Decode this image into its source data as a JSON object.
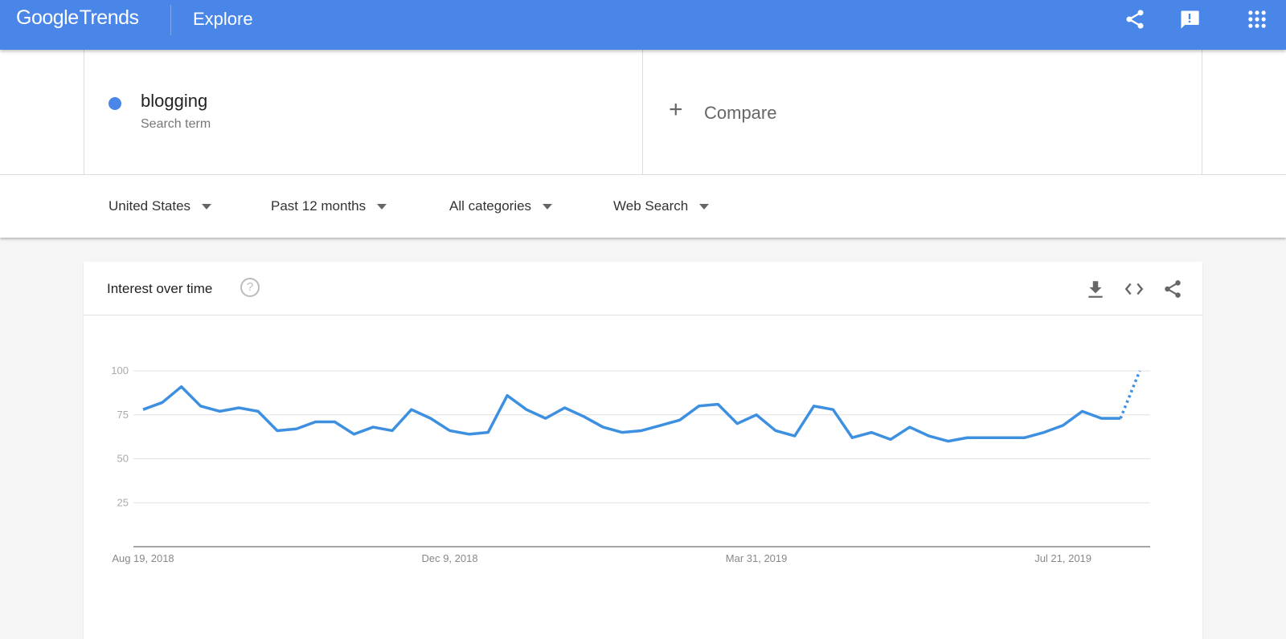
{
  "header": {
    "logo_google": "Google",
    "logo_trends": "Trends",
    "section": "Explore",
    "icons": [
      "share-icon",
      "feedback-icon",
      "apps-grid-icon"
    ],
    "bar_color": "#4a86e8"
  },
  "search": {
    "term": "blogging",
    "term_type": "Search term",
    "term_color": "#4a86e8",
    "compare_label": "Compare",
    "compare_icon": "plus-icon"
  },
  "filters": {
    "region": "United States",
    "time_range": "Past 12 months",
    "category": "All categories",
    "search_type": "Web Search"
  },
  "card": {
    "title": "Interest over time",
    "help_glyph": "?",
    "icons": [
      "download-icon",
      "embed-code-icon",
      "share-icon"
    ]
  },
  "chart_data": {
    "type": "line",
    "title": "Interest over time",
    "xlabel": "",
    "ylabel": "",
    "ylim": [
      0,
      100
    ],
    "yticks": [
      25,
      50,
      75,
      100
    ],
    "grid": true,
    "legend": "none",
    "x_tick_labels": [
      "Aug 19, 2018",
      "Dec 9, 2018",
      "Mar 31, 2019",
      "Jul 21, 2019"
    ],
    "x_tick_indices": [
      0,
      16,
      32,
      48
    ],
    "x_start": "Aug 19, 2018",
    "interval": "weekly",
    "series": [
      {
        "name": "blogging",
        "color": "#3d8fe0",
        "values": [
          78,
          82,
          91,
          80,
          77,
          79,
          77,
          66,
          67,
          71,
          71,
          64,
          68,
          66,
          78,
          73,
          66,
          64,
          65,
          86,
          78,
          73,
          79,
          74,
          68,
          65,
          66,
          69,
          72,
          80,
          81,
          70,
          75,
          66,
          63,
          80,
          78,
          62,
          65,
          61,
          68,
          63,
          60,
          62,
          62,
          62,
          62,
          65,
          69,
          77,
          73,
          73,
          100
        ],
        "partial_from_index": 51
      }
    ]
  }
}
